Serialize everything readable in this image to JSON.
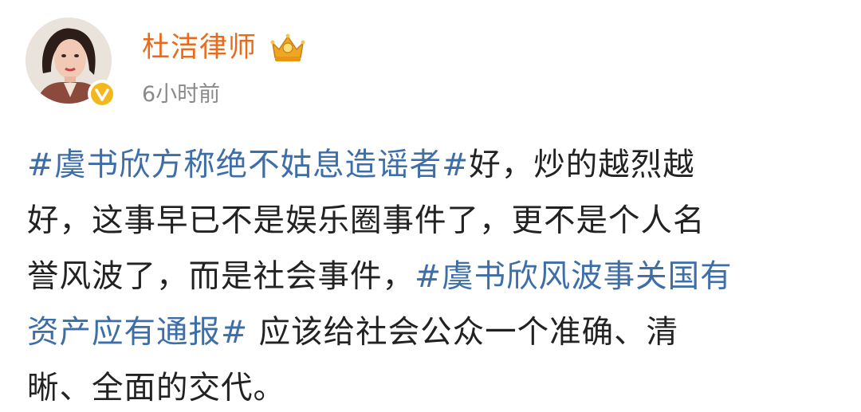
{
  "author": {
    "name": "杜洁律师",
    "time": "6小时前",
    "avatar_icon": "avatar-photo",
    "badge_icon": "verified-v-icon",
    "vip_icon": "crown-vip-icon"
  },
  "post": {
    "lines": [
      [
        {
          "type": "tag",
          "text": "#虞书欣方称绝不姑息造谣者#"
        },
        {
          "type": "text",
          "text": "好，炒的越烈越"
        }
      ],
      [
        {
          "type": "text",
          "text": "好，这事早已不是娱乐圈事件了，更不是个人名"
        }
      ],
      [
        {
          "type": "text",
          "text": "誉风波了，而是社会事件，"
        },
        {
          "type": "tag",
          "text": "#虞书欣风波事关国有"
        }
      ],
      [
        {
          "type": "tag",
          "text": "资产应有通报#"
        },
        {
          "type": "text",
          "text": " 应该给社会公众一个准确、清"
        }
      ],
      [
        {
          "type": "text",
          "text": "晰、全面的交代。"
        }
      ]
    ]
  },
  "colors": {
    "username": "#e86a1d",
    "hashtag": "#3e6ea8",
    "body_text": "#222222",
    "timestamp": "#8a8a8a"
  }
}
